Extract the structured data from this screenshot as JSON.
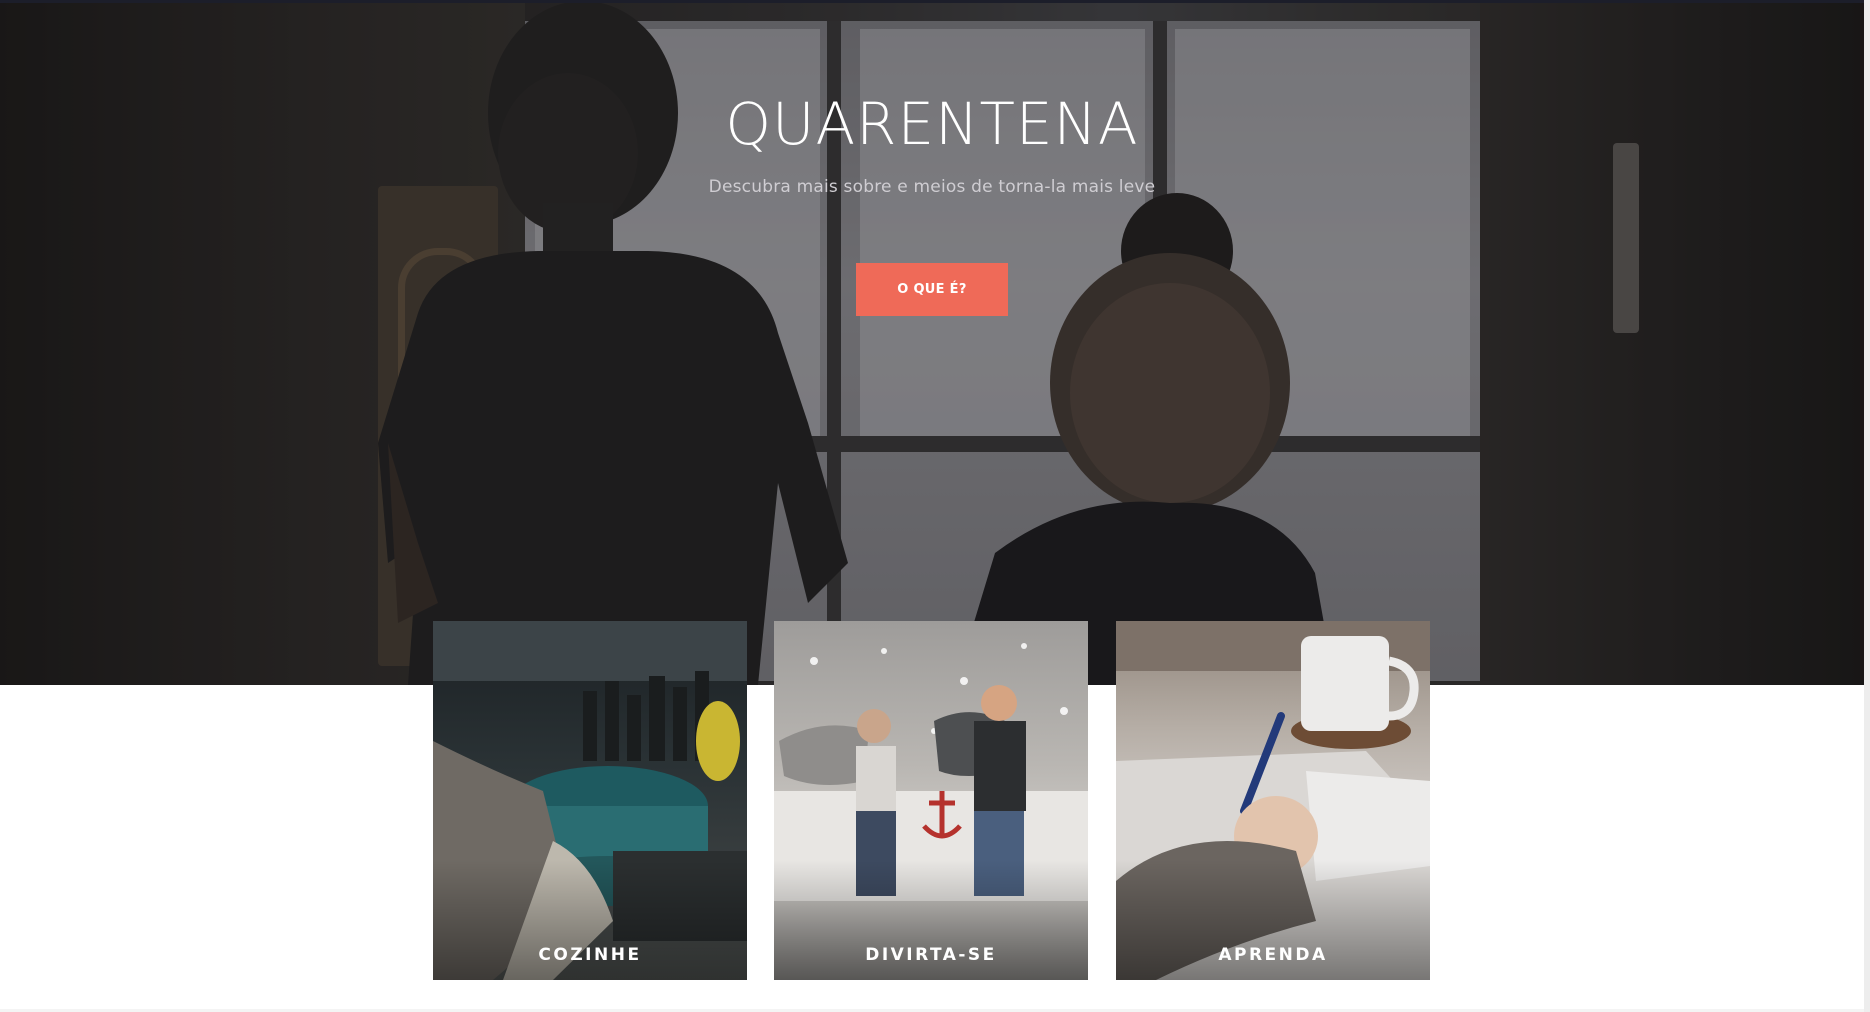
{
  "hero": {
    "title": "QUARENTENA",
    "subtitle": "Descubra mais sobre e meios de torna-la mais leve",
    "cta_label": "O QUE É?"
  },
  "cards": [
    {
      "label": "COZINHE"
    },
    {
      "label": "DIVIRTA-SE"
    },
    {
      "label": "APRENDA"
    }
  ],
  "colors": {
    "accent": "#ef6a58",
    "hero_overlay": "#141418",
    "page_background": "#ffffff"
  }
}
